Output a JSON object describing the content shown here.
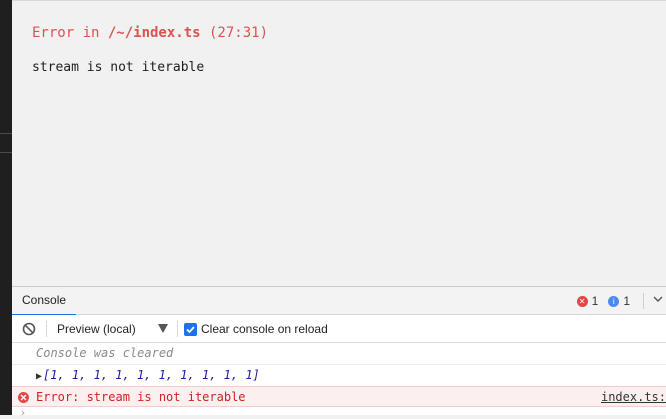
{
  "preview": {
    "error_prefix": "Error in ",
    "error_path": "/~/index.ts",
    "error_location": " (27:31)",
    "error_message": "stream is not iterable"
  },
  "devtools": {
    "tab_console": "Console",
    "error_count": "1",
    "info_count": "1",
    "context_label": "Preview (local)",
    "clear_on_reload_label": "Clear console on reload",
    "clear_on_reload_checked": true
  },
  "console": {
    "cleared_message": "Console was cleared",
    "array_text": "[1, 1, 1, 1, 1, 1, 1, 1, 1, 1]",
    "error_text": "Error: stream is not iterable",
    "source_link": "index.ts:"
  },
  "colors": {
    "error_red": "#d9534f",
    "accent_blue": "#1a73e8",
    "array_blue": "#1c1ca8"
  }
}
